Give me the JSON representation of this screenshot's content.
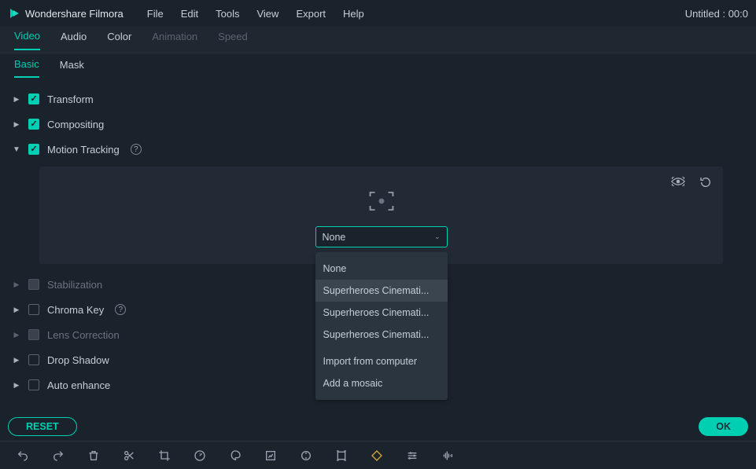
{
  "app_name": "Wondershare Filmora",
  "project_title": "Untitled : 00:0",
  "menu": {
    "file": "File",
    "edit": "Edit",
    "tools": "Tools",
    "view": "View",
    "export": "Export",
    "help": "Help"
  },
  "tabs_top": {
    "video": "Video",
    "audio": "Audio",
    "color": "Color",
    "animation": "Animation",
    "speed": "Speed"
  },
  "tabs_sub": {
    "basic": "Basic",
    "mask": "Mask"
  },
  "groups": {
    "transform": "Transform",
    "compositing": "Compositing",
    "motion_tracking": "Motion Tracking",
    "stabilization": "Stabilization",
    "chroma_key": "Chroma Key",
    "lens_correction": "Lens Correction",
    "drop_shadow": "Drop Shadow",
    "auto_enhance": "Auto enhance"
  },
  "dropdown": {
    "selected": "None",
    "options": {
      "o0": "None",
      "o1": "Superheroes Cinemati...",
      "o2": "Superheroes Cinemati...",
      "o3": "Superheroes Cinemati...",
      "o4": "Import from computer",
      "o5": "Add a mosaic"
    }
  },
  "buttons": {
    "reset": "RESET",
    "ok": "OK"
  },
  "help_glyph": "?"
}
